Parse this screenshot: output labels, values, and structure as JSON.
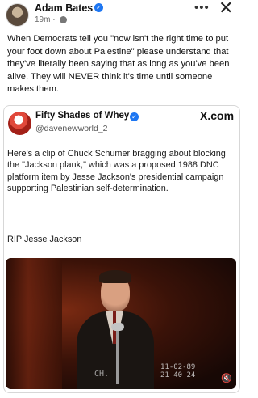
{
  "post": {
    "author": "Adam Bates",
    "time": "19m ·",
    "text": "When Democrats tell you \"now isn't the right time to put your foot down about Palestine\" please understand that they've literally been saying that as long as you've been alive. They will NEVER think it's time until someone makes them."
  },
  "icons": {
    "verified": "verified-badge-icon",
    "globe": "globe-icon",
    "more": "more-options-icon",
    "close": "close-icon",
    "mute": "volume-muted-icon"
  },
  "embed": {
    "name": "Fifty Shades of Whey",
    "handle": "@davenewworld_2",
    "source": "X.com",
    "text": "Here's a clip of Chuck Schumer bragging about blocking the \"Jackson plank,\" which was a proposed 1988 DNC platform item by Jesse Jackson's presidential campaign supporting Palestinian self-determination.",
    "footer": "RIP Jesse Jackson",
    "video": {
      "overlay_text": "CH.",
      "date": "11-02-89",
      "time": "21 40 24"
    }
  },
  "colors": {
    "verified_blue": "#1d76f2",
    "text": "#111111",
    "muted": "#6b6b6b"
  }
}
